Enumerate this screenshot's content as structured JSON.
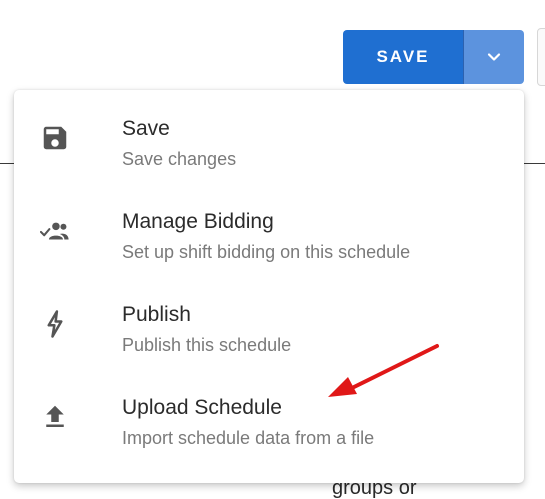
{
  "toolbar": {
    "save_label": "SAVE",
    "caret_icon": "chevron-down-icon",
    "primary_color": "#1f6fd1",
    "secondary_color": "#5c93de"
  },
  "menu": {
    "items": [
      {
        "title": "Save",
        "subtitle": "Save changes",
        "icon": "floppy-disk-icon"
      },
      {
        "title": "Manage Bidding",
        "subtitle": "Set up shift bidding on this schedule",
        "icon": "people-check-icon"
      },
      {
        "title": "Publish",
        "subtitle": "Publish this schedule",
        "icon": "lightning-bolt-icon"
      },
      {
        "title": "Upload Schedule",
        "subtitle": "Import schedule data from a file",
        "icon": "upload-icon"
      }
    ]
  },
  "background": {
    "partial_text": "groups or"
  },
  "annotation": {
    "arrow_color": "#e01818"
  }
}
